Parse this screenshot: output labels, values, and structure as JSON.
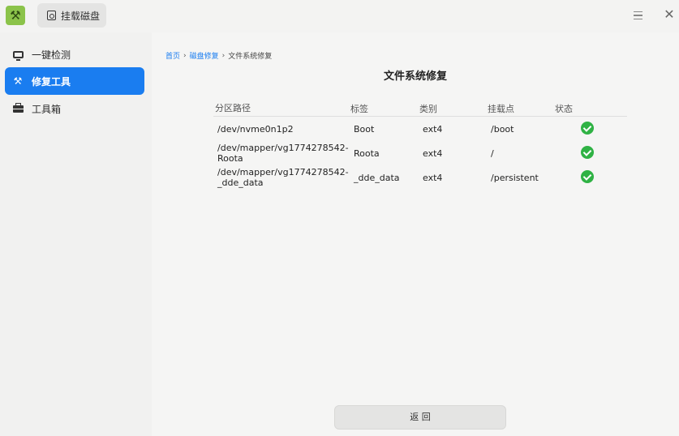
{
  "titlebar": {
    "mount_label": "挂载磁盘",
    "app_icon": "tools-icon",
    "menu_icon": "menu-icon",
    "close_icon": "close-icon"
  },
  "sidebar": {
    "items": [
      {
        "label": "一键检测",
        "icon": "monitor-icon"
      },
      {
        "label": "修复工具",
        "icon": "tools-icon",
        "active": true
      },
      {
        "label": "工具箱",
        "icon": "toolbox-icon"
      }
    ],
    "accent": "#1a7df0"
  },
  "breadcrumb": {
    "home": "首页",
    "repair": "磁盘修复",
    "current": "文件系统修复"
  },
  "page": {
    "title": "文件系统修复",
    "back_label": "返 回"
  },
  "table": {
    "headers": [
      "分区路径",
      "标签",
      "类别",
      "挂载点",
      "状态"
    ],
    "rows": [
      {
        "path": "/dev/nvme0n1p2",
        "label": "Boot",
        "type": "ext4",
        "mount": "/boot",
        "status": "ok"
      },
      {
        "path": "/dev/mapper/vg1774278542-Roota",
        "label": "Roota",
        "type": "ext4",
        "mount": "/",
        "status": "ok"
      },
      {
        "path": "/dev/mapper/vg1774278542-_dde_data",
        "label": "_dde_data",
        "type": "ext4",
        "mount": "/persistent",
        "status": "ok"
      }
    ],
    "status_color": "#2fb244"
  }
}
